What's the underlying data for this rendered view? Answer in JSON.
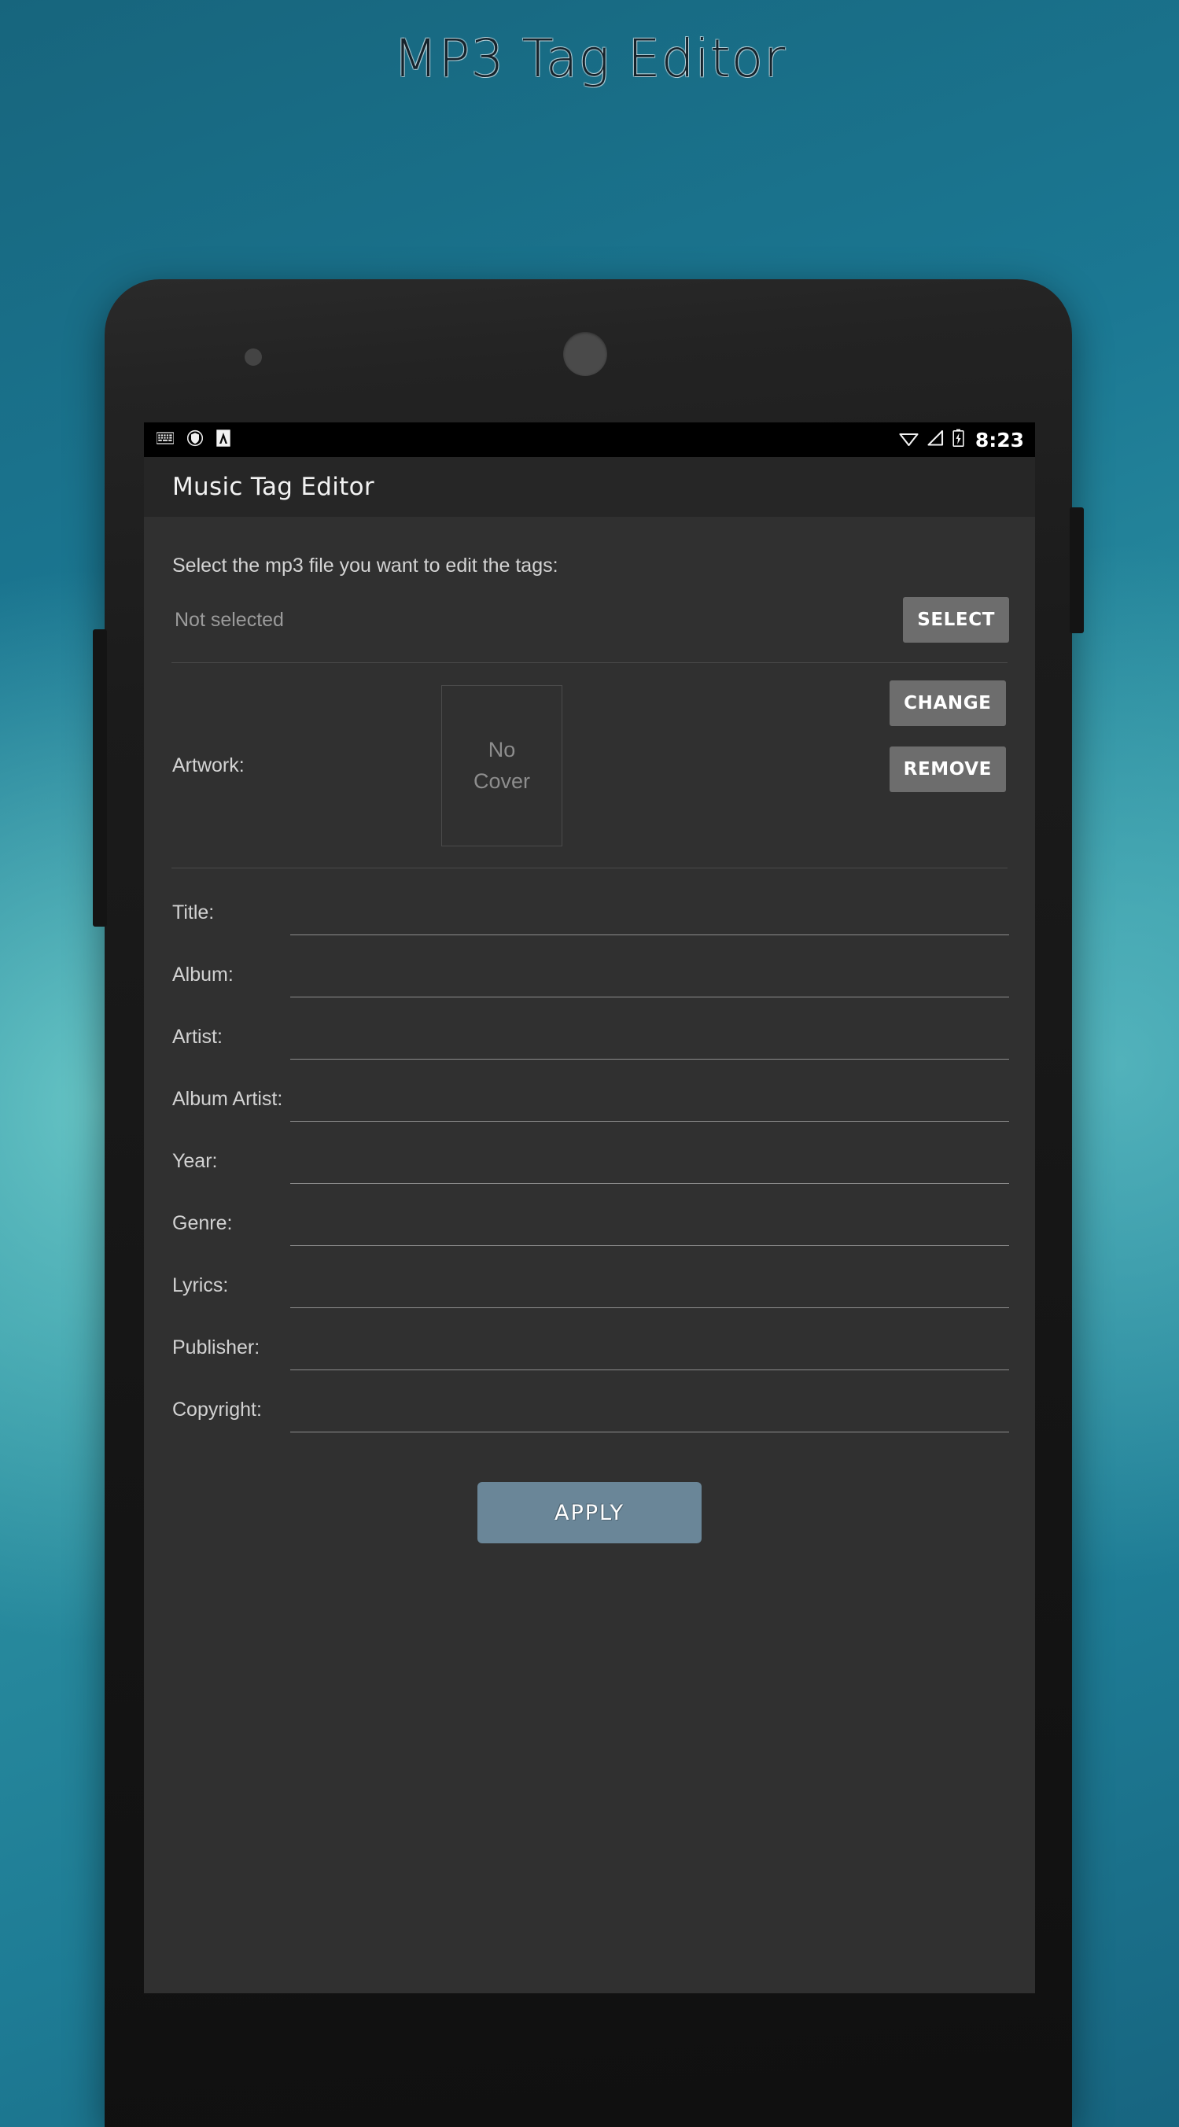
{
  "page": {
    "title": "MP3 Tag Editor"
  },
  "status_bar": {
    "icons_left": [
      "keyboard-icon",
      "shield-icon",
      "app-notification-icon"
    ],
    "icons_right": [
      "wifi-icon",
      "signal-icon",
      "battery-charging-icon"
    ],
    "clock": "8:23"
  },
  "app_bar": {
    "title": "Music Tag Editor"
  },
  "content": {
    "select_hint": "Select the mp3 file you want to edit the tags:",
    "file": {
      "name": "Not selected",
      "select_label": "SELECT"
    },
    "artwork": {
      "label": "Artwork:",
      "placeholder_line1": "No",
      "placeholder_line2": "Cover",
      "change_label": "CHANGE",
      "remove_label": "REMOVE"
    },
    "fields": [
      {
        "label": "Title:",
        "value": "",
        "placeholder": ""
      },
      {
        "label": "Album:",
        "value": "",
        "placeholder": ""
      },
      {
        "label": "Artist:",
        "value": "",
        "placeholder": ""
      },
      {
        "label": "Album Artist:",
        "value": "",
        "placeholder": ""
      },
      {
        "label": "Year:",
        "value": "",
        "placeholder": ""
      },
      {
        "label": "Genre:",
        "value": "",
        "placeholder": ""
      },
      {
        "label": "Lyrics:",
        "value": "",
        "placeholder": ""
      },
      {
        "label": "Publisher:",
        "value": "",
        "placeholder": ""
      },
      {
        "label": "Copyright:",
        "value": "",
        "placeholder": ""
      }
    ],
    "apply_label": "APPLY"
  },
  "colors": {
    "background_teal_dark": "#17657d",
    "background_teal_light": "#2e93a3",
    "screen_background": "#303030",
    "app_bar": "#262626",
    "status_bar": "#000000",
    "button_gray": "#6d6d6d",
    "apply_button": "#6a8698",
    "phone_frame": "#1b1b1b"
  }
}
